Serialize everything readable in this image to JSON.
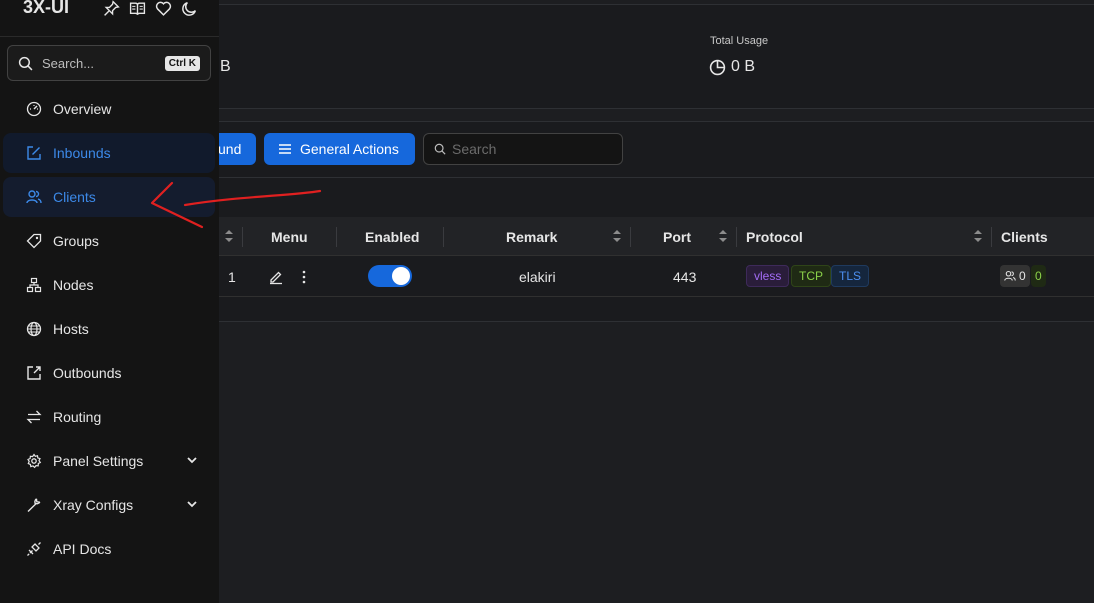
{
  "app": {
    "title": "3X-UI"
  },
  "header_icons": [
    "pin-icon",
    "docs-icon",
    "heart-icon",
    "moon-icon"
  ],
  "sidebar": {
    "search_placeholder": "Search...",
    "shortcut": "Ctrl K",
    "items": [
      {
        "label": "Overview",
        "icon": "dashboard-icon"
      },
      {
        "label": "Inbounds",
        "icon": "edit-square-icon",
        "selected": true
      },
      {
        "label": "Clients",
        "icon": "users-icon",
        "hovered": true
      },
      {
        "label": "Groups",
        "icon": "tag-icon"
      },
      {
        "label": "Nodes",
        "icon": "cluster-icon"
      },
      {
        "label": "Hosts",
        "icon": "globe-icon"
      },
      {
        "label": "Outbounds",
        "icon": "external-link-icon"
      },
      {
        "label": "Routing",
        "icon": "swap-icon"
      },
      {
        "label": "Panel Settings",
        "icon": "gear-icon",
        "expandable": true
      },
      {
        "label": "Xray Configs",
        "icon": "tool-icon",
        "expandable": true
      },
      {
        "label": "API Docs",
        "icon": "api-icon"
      }
    ]
  },
  "stats": {
    "partial_value": "B",
    "total_usage_label": "Total Usage",
    "total_usage_value": "0 B"
  },
  "toolbar": {
    "add_label_partial": "und",
    "general_actions_label": "General Actions",
    "search_placeholder": "Search"
  },
  "table": {
    "columns": [
      "Menu",
      "Enabled",
      "Remark",
      "Port",
      "Protocol",
      "Clients"
    ],
    "rows": [
      {
        "id": "1",
        "enabled": true,
        "remark": "elakiri",
        "port": "443",
        "protocol_tags": [
          "vless",
          "TCP",
          "TLS"
        ],
        "clients_total": "0",
        "clients_online": "0"
      }
    ]
  },
  "colors": {
    "accent": "#1668dc",
    "sidebar_bg": "#141414",
    "selected_text": "#3c89e8",
    "annotation": "#e02020"
  }
}
